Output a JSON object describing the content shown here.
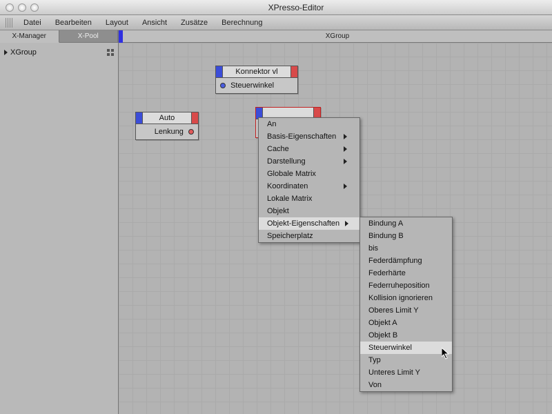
{
  "window": {
    "title": "XPresso-Editor"
  },
  "menubar": {
    "items": [
      "Datei",
      "Bearbeiten",
      "Layout",
      "Ansicht",
      "Zusätze",
      "Berechnung"
    ]
  },
  "sidebar": {
    "tabs": [
      {
        "label": "X-Manager",
        "active": true
      },
      {
        "label": "X-Pool",
        "active": false
      }
    ],
    "tree": {
      "root": "XGroup"
    }
  },
  "canvas": {
    "title": "XGroup"
  },
  "nodes": {
    "auto": {
      "title": "Auto",
      "ports_out": [
        "Lenkung"
      ]
    },
    "konnektor_vl": {
      "title": "Konnektor vl",
      "ports_in": [
        "Steuerwinkel"
      ]
    },
    "selected": {
      "title": ""
    }
  },
  "context_menu": {
    "items": [
      {
        "label": "An",
        "submenu": false
      },
      {
        "label": "Basis-Eigenschaften",
        "submenu": true
      },
      {
        "label": "Cache",
        "submenu": true
      },
      {
        "label": "Darstellung",
        "submenu": true
      },
      {
        "label": "Globale Matrix",
        "submenu": false
      },
      {
        "label": "Koordinaten",
        "submenu": true
      },
      {
        "label": "Lokale Matrix",
        "submenu": false
      },
      {
        "label": "Objekt",
        "submenu": false
      },
      {
        "label": "Objekt-Eigenschaften",
        "submenu": true,
        "highlighted": true
      },
      {
        "label": "Speicherplatz",
        "submenu": false
      }
    ]
  },
  "submenu": {
    "items": [
      "Bindung A",
      "Bindung B",
      "bis",
      "Federdämpfung",
      "Federhärte",
      "Federruheposition",
      "Kollision ignorieren",
      "Oberes Limit Y",
      "Objekt A",
      "Objekt B",
      "Steuerwinkel",
      "Typ",
      "Unteres Limit Y",
      "Von"
    ],
    "highlighted": "Steuerwinkel"
  }
}
